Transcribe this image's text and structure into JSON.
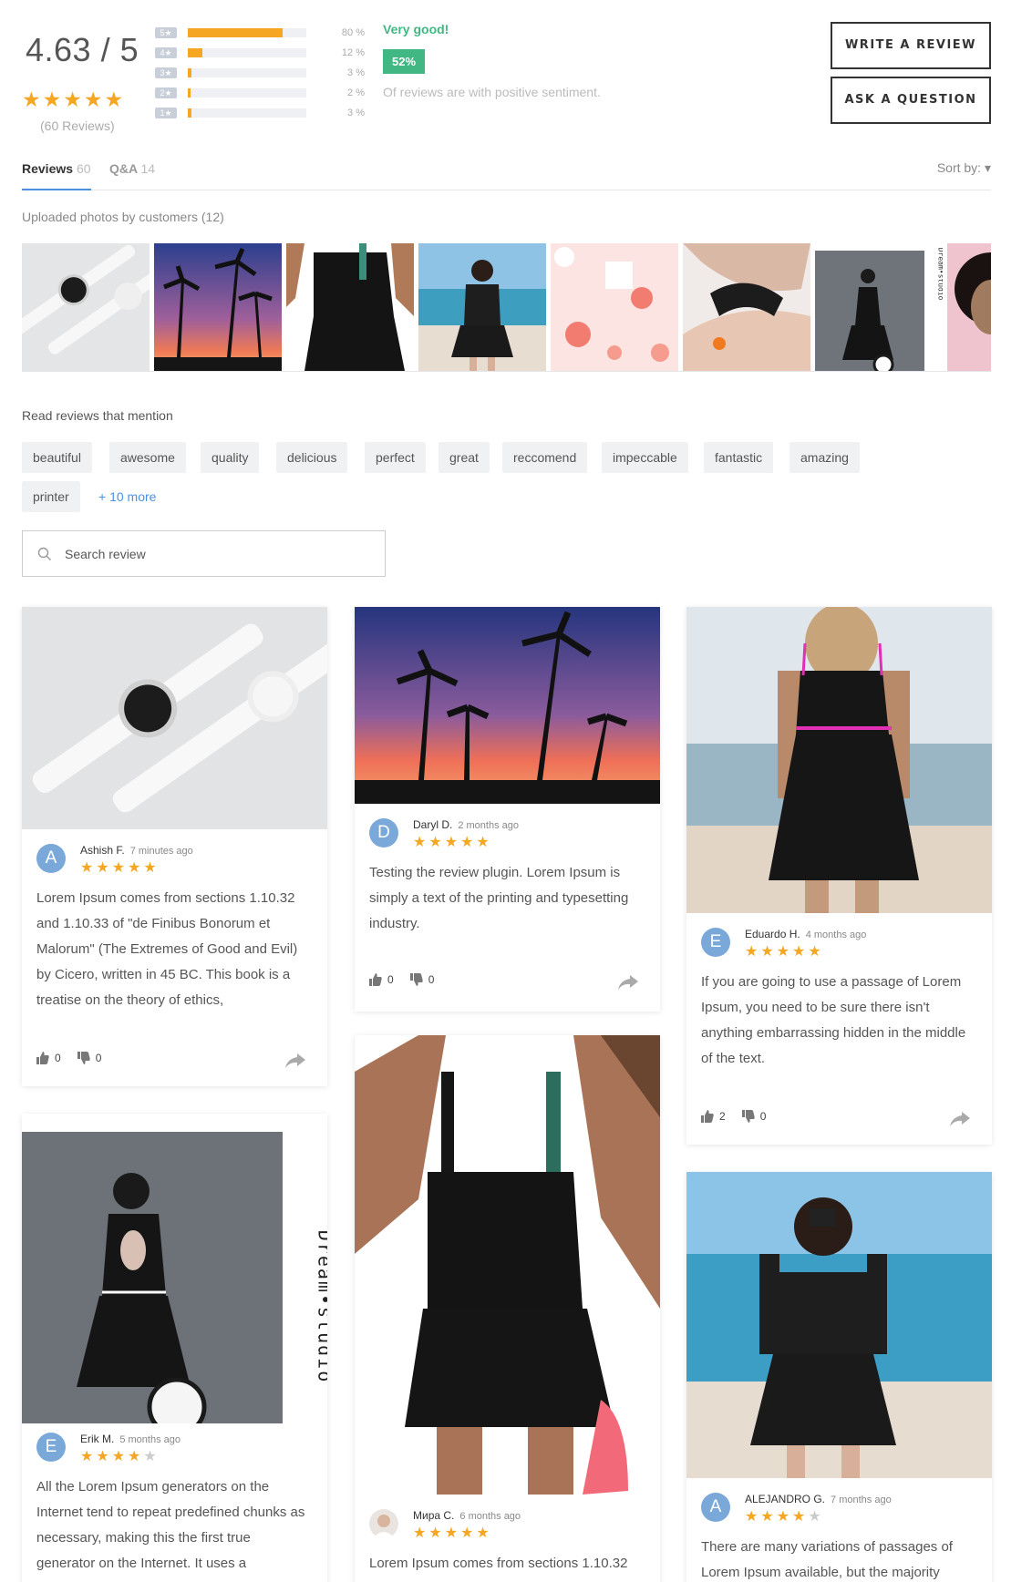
{
  "summary": {
    "average": "4.63 / 5",
    "stars": "★★★★★",
    "count_label": "(60 Reviews)",
    "bars": [
      {
        "label": "5★",
        "percent": 80,
        "percent_label": "80 %"
      },
      {
        "label": "4★",
        "percent": 12,
        "percent_label": "12 %"
      },
      {
        "label": "3★",
        "percent": 3,
        "percent_label": "3 %"
      },
      {
        "label": "2★",
        "percent": 2,
        "percent_label": "2 %"
      },
      {
        "label": "1★",
        "percent": 3,
        "percent_label": "3 %"
      }
    ],
    "sentiment_title": "Very good!",
    "sentiment_value": "52%",
    "sentiment_text": "Of reviews are with positive sentiment.",
    "write_review": "WRITE A REVIEW",
    "ask_question": "ASK A QUESTION"
  },
  "tabs": {
    "reviews_label": "Reviews",
    "reviews_count": "60",
    "qa_label": "Q&A",
    "qa_count": "14",
    "sort_label": "Sort by: ▾"
  },
  "photos": {
    "title": "Uploaded photos by customers (12)"
  },
  "mentions": {
    "title": "Read reviews that mention",
    "tags": [
      "beautiful",
      "awesome",
      "quality",
      "delicious",
      "perfect",
      "great",
      "reccomend",
      "impeccable",
      "fantastic",
      "amazing",
      "printer"
    ],
    "more": "+ 10 more"
  },
  "search": {
    "placeholder": "Search review"
  },
  "reviews": [
    {
      "initial": "A",
      "author": "Ashish F.",
      "time": "7 minutes ago",
      "rating": 5,
      "text": "Lorem Ipsum comes from sections 1.10.32 and 1.10.33 of \"de Finibus Bonorum et Malorum\" (The Extremes of Good and Evil) by Cicero, written in 45 BC. This book is a treatise on the theory of ethics,",
      "likes": "0",
      "dislikes": "0"
    },
    {
      "initial": "D",
      "author": "Daryl D.",
      "time": "2 months ago",
      "rating": 5,
      "text": "Testing the review plugin. Lorem Ipsum is simply a text of the printing and typesetting industry.",
      "likes": "0",
      "dislikes": "0"
    },
    {
      "initial": "E",
      "author": "Eduardo H.",
      "time": "4 months ago",
      "rating": 5,
      "text": "If you are going to use a passage of Lorem Ipsum, you need to be sure there isn't anything embarrassing hidden in the middle of the text.",
      "likes": "2",
      "dislikes": "0"
    },
    {
      "initial": "E",
      "author": "Erik M.",
      "time": "5 months ago",
      "rating": 4,
      "text": "All the Lorem Ipsum generators on the Internet tend to repeat predefined chunks as necessary, making this the first true generator on the Internet. It uses a"
    },
    {
      "initial": "",
      "author": "Мира С.",
      "time": "6 months ago",
      "rating": 5,
      "text": "Lorem Ipsum comes from sections 1.10.32"
    },
    {
      "initial": "A",
      "author": "ALEJANDRO G.",
      "time": "7 months ago",
      "rating": 4,
      "text": "There are many variations of passages of Lorem Ipsum available, but the majority"
    }
  ],
  "photo_watermark": "Dream•studio",
  "colors": {
    "star": "#f5a623",
    "positive": "#41b883",
    "link": "#4a90e2",
    "avatar": "#7aa8d8"
  }
}
